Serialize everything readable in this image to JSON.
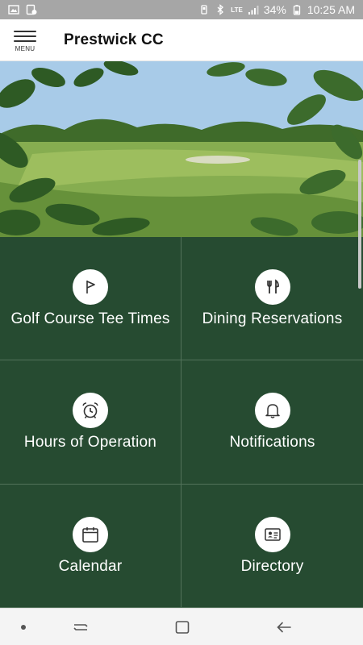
{
  "status_bar": {
    "battery": "34%",
    "time": "10:25 AM",
    "network": "LTE"
  },
  "app_bar": {
    "menu_label": "MENU",
    "title": "Prestwick CC"
  },
  "hero": {
    "icon": "golf-course-photo"
  },
  "tiles": [
    {
      "label": "Golf Course Tee Times",
      "icon": "flag-icon"
    },
    {
      "label": "Dining Reservations",
      "icon": "utensils-icon"
    },
    {
      "label": "Hours of Operation",
      "icon": "alarm-clock-icon"
    },
    {
      "label": "Notifications",
      "icon": "bell-icon"
    },
    {
      "label": "Calendar",
      "icon": "calendar-icon"
    },
    {
      "label": "Directory",
      "icon": "id-card-icon"
    }
  ],
  "colors": {
    "tile_background": "#264b31",
    "tile_divider": "#52725a",
    "status_bar": "#a6a6a6"
  }
}
